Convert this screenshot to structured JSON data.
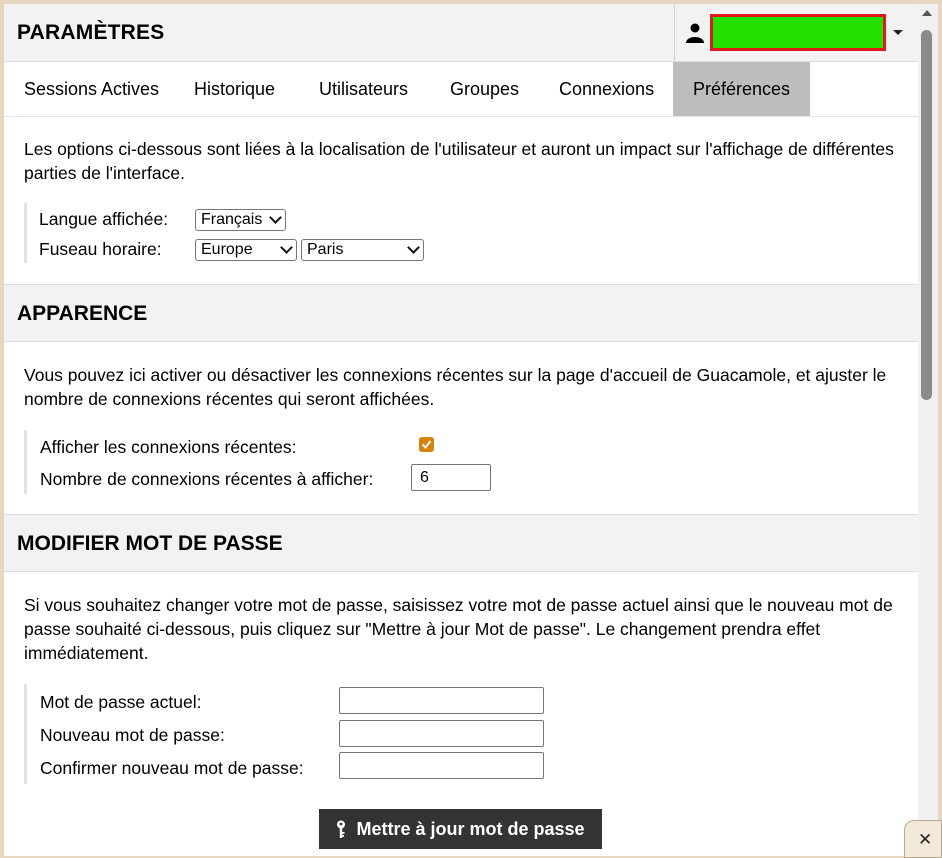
{
  "header": {
    "title": "PARAMÈTRES"
  },
  "tabs": [
    {
      "label": "Sessions Actives"
    },
    {
      "label": "Historique"
    },
    {
      "label": "Utilisateurs"
    },
    {
      "label": "Groupes"
    },
    {
      "label": "Connexions"
    },
    {
      "label": "Préférences",
      "active": true
    }
  ],
  "locale": {
    "description": "Les options ci-dessous sont liées à la localisation de l'utilisateur et auront un impact sur l'affichage de différentes parties de l'interface.",
    "language_label": "Langue affichée:",
    "language_value": "Français",
    "timezone_label": "Fuseau horaire:",
    "timezone_region": "Europe",
    "timezone_city": "Paris"
  },
  "appearance": {
    "title": "APPARENCE",
    "description": "Vous pouvez ici activer ou désactiver les connexions récentes sur la page d'accueil de Guacamole, et ajuster le nombre de connexions récentes qui seront affichées.",
    "show_recent_label": "Afficher les connexions récentes:",
    "show_recent_checked": true,
    "recent_count_label": "Nombre de connexions récentes à afficher:",
    "recent_count_value": "6"
  },
  "password": {
    "title": "MODIFIER MOT DE PASSE",
    "description": "Si vous souhaitez changer votre mot de passe, saisissez votre mot de passe actuel ainsi que le nouveau mot de passe souhaité ci-dessous, puis cliquez sur \"Mettre à jour Mot de passe\". Le changement prendra effet immédiatement.",
    "current_label": "Mot de passe actuel:",
    "new_label": "Nouveau mot de passe:",
    "confirm_label": "Confirmer nouveau mot de passe:",
    "submit_label": "Mettre à jour mot de passe"
  },
  "colors": {
    "accent_checkbox": "#d4830f",
    "active_tab": "#bdbdbd",
    "button": "#333333",
    "redacted_fill": "#22e000",
    "redacted_border": "#e01a1a"
  },
  "icons": {
    "user": "user-icon",
    "caret": "chevron-down-icon",
    "key": "key-icon",
    "close": "close-icon"
  },
  "close_glyph": "✕"
}
